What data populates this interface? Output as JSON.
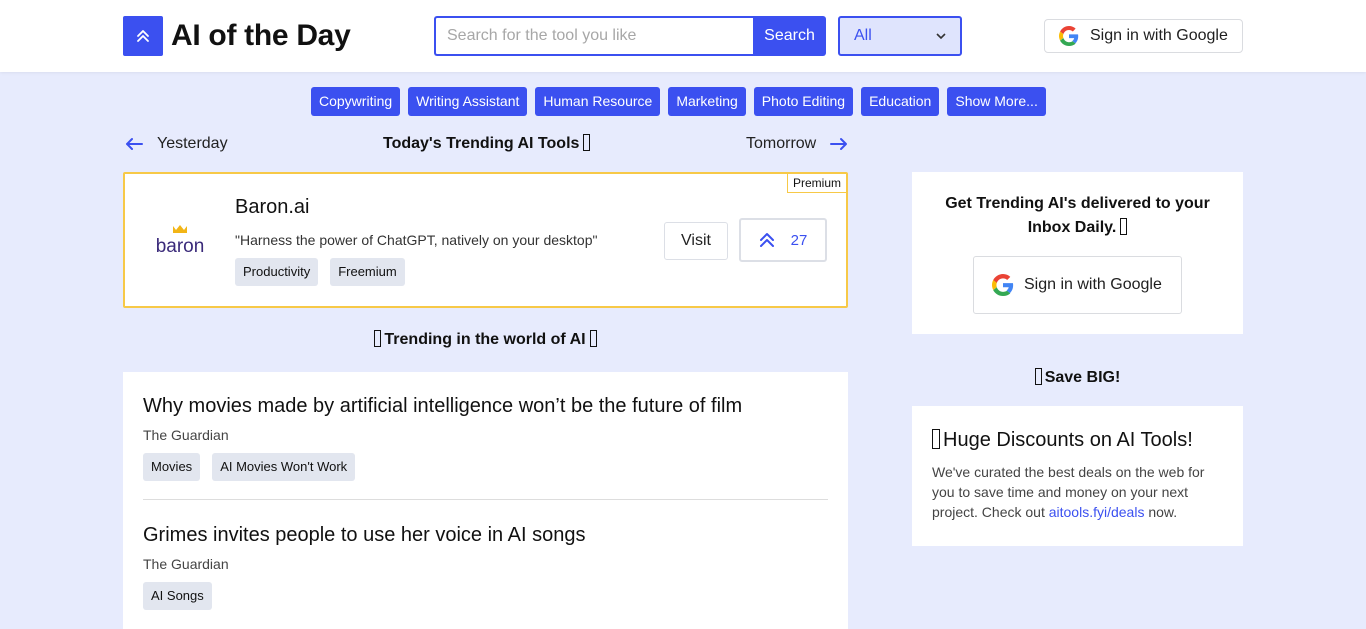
{
  "header": {
    "logo_text": "AI of the Day",
    "search_placeholder": "Search for the tool you like",
    "search_button": "Search",
    "category_selected": "All",
    "sign_in": "Sign in with Google"
  },
  "categories": [
    "Copywriting",
    "Writing Assistant",
    "Human Resource",
    "Marketing",
    "Photo Editing",
    "Education",
    "Show More..."
  ],
  "day_nav": {
    "prev": "Yesterday",
    "title": "Today's Trending AI Tools",
    "next": "Tomorrow"
  },
  "featured": {
    "badge": "Premium",
    "logo_text": "baron",
    "name": "Baron.ai",
    "description": "\"Harness the power of ChatGPT, natively on your desktop\"",
    "tags": [
      "Productivity",
      "Freemium"
    ],
    "visit": "Visit",
    "upvotes": "27"
  },
  "trending_heading": "Trending in the world of AI",
  "news": [
    {
      "title": "Why movies made by artificial intelligence won’t be the future of film",
      "source": "The Guardian",
      "tags": [
        "Movies",
        "AI Movies Won't Work"
      ]
    },
    {
      "title": "Grimes invites people to use her voice in AI songs",
      "source": "The Guardian",
      "tags": [
        "AI Songs"
      ]
    }
  ],
  "sidebar": {
    "newsletter_heading": "Get Trending AI's delivered to your Inbox Daily.",
    "sign_in": "Sign in with Google",
    "save_heading": "Save BIG!",
    "deals_title": "Huge Discounts on AI Tools!",
    "deals_text_1": "We've curated the best deals on the web for you to save time and money on your next project. Check out ",
    "deals_link": "aitools.fyi/deals",
    "deals_text_2": " now."
  },
  "colors": {
    "accent": "#3b50f0",
    "background": "#e7ebfd",
    "premium_border": "#f7c948"
  }
}
